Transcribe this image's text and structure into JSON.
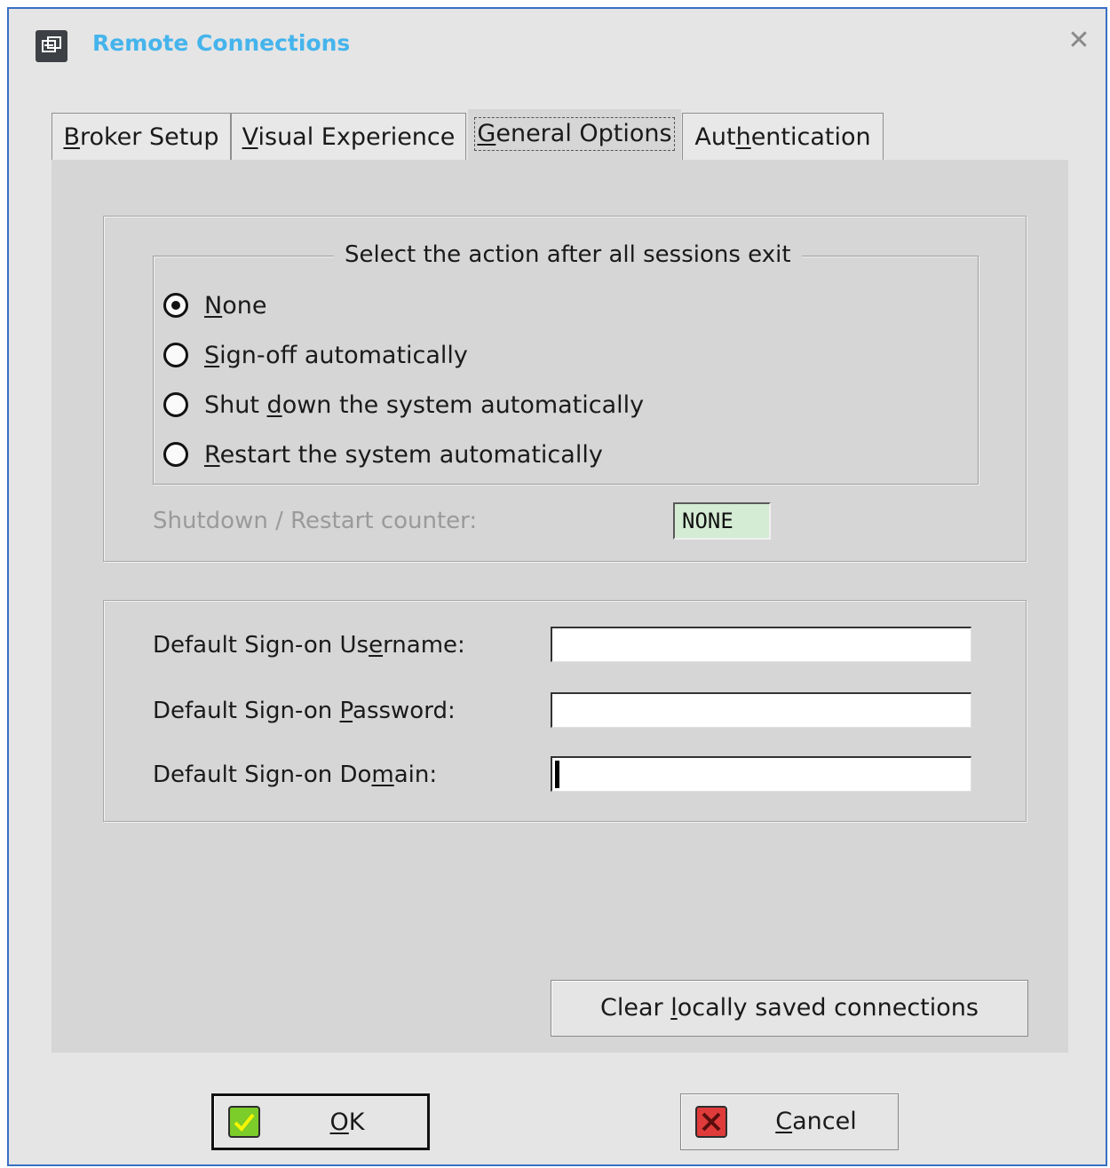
{
  "window": {
    "title": "Remote Connections",
    "close_icon": "close-icon"
  },
  "tabs": [
    {
      "label": "Broker Setup",
      "mnemonic": "B",
      "active": false
    },
    {
      "label": "Visual Experience",
      "mnemonic": "V",
      "active": false
    },
    {
      "label": "General Options",
      "mnemonic": "G",
      "active": true
    },
    {
      "label": "Authentication",
      "mnemonic": "h",
      "active": false
    }
  ],
  "session_exit": {
    "legend": "Select the action after all sessions exit",
    "options": [
      {
        "label": "None",
        "checked": true
      },
      {
        "label": "Sign-off automatically",
        "checked": false
      },
      {
        "label": "Shut down the system automatically",
        "checked": false
      },
      {
        "label": "Restart the system automatically",
        "checked": false
      }
    ],
    "counter_label": "Shutdown / Restart counter:",
    "counter_value": "NONE"
  },
  "sign_on": {
    "username_label": "Default Sign-on Username:",
    "username_value": "",
    "password_label": "Default Sign-on Password:",
    "password_value": "",
    "domain_label": "Default Sign-on Domain:",
    "domain_value": ""
  },
  "buttons": {
    "clear": "Clear locally saved connections",
    "ok": "OK",
    "cancel": "Cancel"
  },
  "colors": {
    "title": "#45b4ec",
    "window_border": "#3a6fc4",
    "counter_bg": "#d4ecd4",
    "ok_icon": "#7ccc2a",
    "cancel_icon": "#e03b3b"
  }
}
